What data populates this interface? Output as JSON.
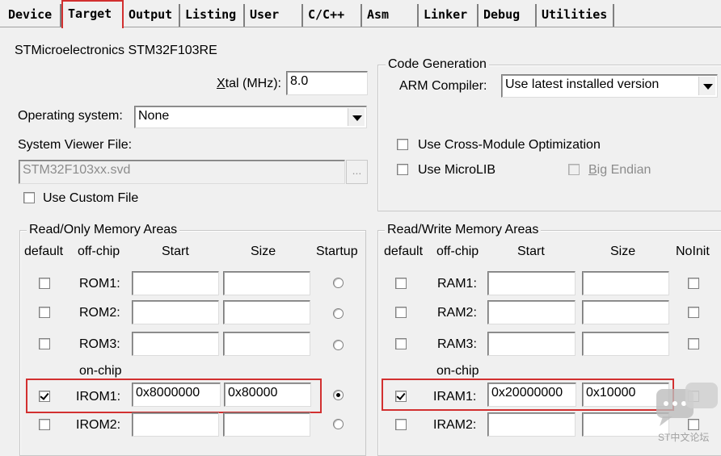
{
  "tabs": [
    "Device",
    "Target",
    "Output",
    "Listing",
    "User",
    "C/C++",
    "Asm",
    "Linker",
    "Debug",
    "Utilities"
  ],
  "device_name": "STMicroelectronics STM32F103RE",
  "xtal": {
    "label_u": "X",
    "label_rest": "tal (MHz):",
    "value": "8.0"
  },
  "os": {
    "label": "Operating system:",
    "value": "None"
  },
  "svf": {
    "label": "System Viewer File:",
    "value": "STM32F103xx.svd",
    "browse": "..."
  },
  "custom_file": {
    "label": "Use Custom File",
    "checked": false
  },
  "codegen": {
    "title": "Code Generation",
    "compiler_label": "ARM Compiler:",
    "compiler_value": "Use latest installed version",
    "cross_module": "Use Cross-Module Optimization",
    "microlib": "Use MicroLIB",
    "big_endian_u": "B",
    "big_endian_rest": "ig Endian"
  },
  "ro": {
    "title": "Read/Only Memory Areas",
    "headers": {
      "default": "default",
      "offchip": "off-chip",
      "start": "Start",
      "size": "Size",
      "startup": "Startup"
    },
    "onchip_label": "on-chip",
    "rows": [
      {
        "name": "ROM1:",
        "start": "",
        "size": ""
      },
      {
        "name": "ROM2:",
        "start": "",
        "size": ""
      },
      {
        "name": "ROM3:",
        "start": "",
        "size": ""
      },
      {
        "name": "IROM1:",
        "start": "0x8000000",
        "size": "0x80000"
      },
      {
        "name": "IROM2:",
        "start": "",
        "size": ""
      }
    ]
  },
  "rw": {
    "title": "Read/Write Memory Areas",
    "headers": {
      "default": "default",
      "offchip": "off-chip",
      "start": "Start",
      "size": "Size",
      "noinit": "NoInit"
    },
    "onchip_label": "on-chip",
    "rows": [
      {
        "name": "RAM1:",
        "start": "",
        "size": ""
      },
      {
        "name": "RAM2:",
        "start": "",
        "size": ""
      },
      {
        "name": "RAM3:",
        "start": "",
        "size": ""
      },
      {
        "name": "IRAM1:",
        "start": "0x20000000",
        "size": "0x10000"
      },
      {
        "name": "IRAM2:",
        "start": "",
        "size": ""
      }
    ]
  },
  "watermark_text": "ST中文论坛",
  "colors": {
    "highlight": "#d23030",
    "window_bg": "#f0f0f0"
  }
}
